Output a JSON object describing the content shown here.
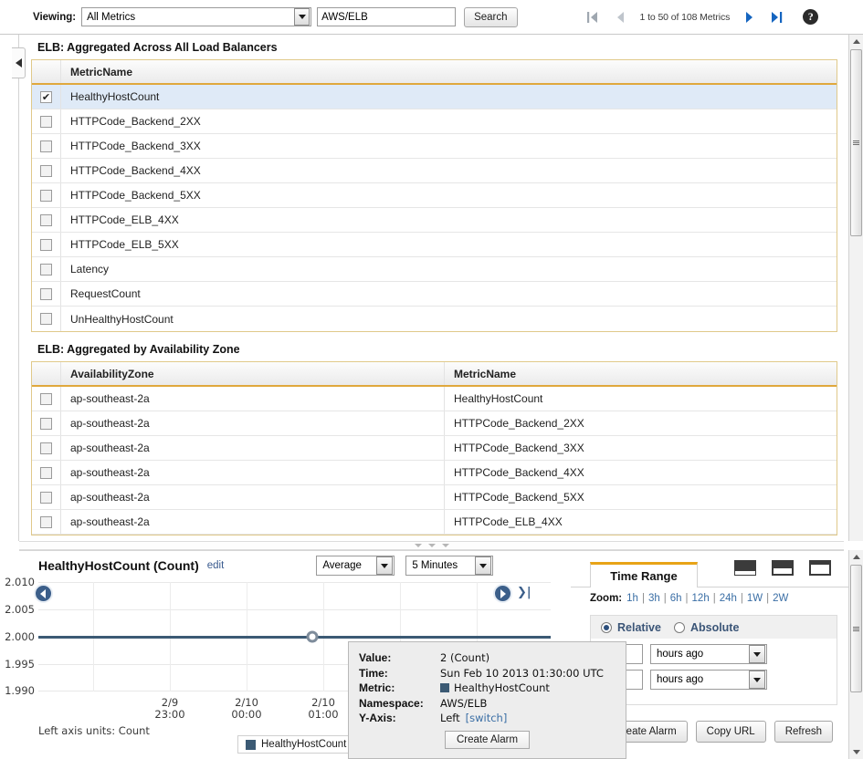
{
  "toolbar": {
    "viewing_label": "Viewing:",
    "namespace_select": "All Metrics",
    "filter_value": "AWS/ELB",
    "search_button": "Search",
    "pagination": "1 to 50 of 108 Metrics",
    "help_glyph": "?",
    "first_icon": "|◀",
    "prev_icon": "◀",
    "next_icon": "▶",
    "last_icon": "▶|"
  },
  "sections": [
    {
      "title": "ELB: Aggregated Across All Load Balancers",
      "columns": [
        "MetricName"
      ],
      "rows": [
        {
          "checked": true,
          "metric": "HealthyHostCount"
        },
        {
          "checked": false,
          "metric": "HTTPCode_Backend_2XX"
        },
        {
          "checked": false,
          "metric": "HTTPCode_Backend_3XX"
        },
        {
          "checked": false,
          "metric": "HTTPCode_Backend_4XX"
        },
        {
          "checked": false,
          "metric": "HTTPCode_Backend_5XX"
        },
        {
          "checked": false,
          "metric": "HTTPCode_ELB_4XX"
        },
        {
          "checked": false,
          "metric": "HTTPCode_ELB_5XX"
        },
        {
          "checked": false,
          "metric": "Latency"
        },
        {
          "checked": false,
          "metric": "RequestCount"
        },
        {
          "checked": false,
          "metric": "UnHealthyHostCount"
        }
      ]
    },
    {
      "title": "ELB: Aggregated by Availability Zone",
      "columns": [
        "AvailabilityZone",
        "MetricName"
      ],
      "rows": [
        {
          "checked": false,
          "zone": "ap-southeast-2a",
          "metric": "HealthyHostCount"
        },
        {
          "checked": false,
          "zone": "ap-southeast-2a",
          "metric": "HTTPCode_Backend_2XX"
        },
        {
          "checked": false,
          "zone": "ap-southeast-2a",
          "metric": "HTTPCode_Backend_3XX"
        },
        {
          "checked": false,
          "zone": "ap-southeast-2a",
          "metric": "HTTPCode_Backend_4XX"
        },
        {
          "checked": false,
          "zone": "ap-southeast-2a",
          "metric": "HTTPCode_Backend_5XX"
        },
        {
          "checked": false,
          "zone": "ap-southeast-2a",
          "metric": "HTTPCode_ELB_4XX"
        }
      ]
    }
  ],
  "chart_panel": {
    "title": "HealthyHostCount (Count)",
    "edit_link": "edit",
    "statistic": "Average",
    "period": "5 Minutes",
    "axis_units": "Left axis units: Count",
    "legend_label": "HealthyHostCount",
    "prev_icon": "❮",
    "next_icon": "❯",
    "last_icon": "❯|"
  },
  "chart_data": {
    "type": "line",
    "title": "HealthyHostCount (Count)",
    "xlabel": "",
    "ylabel": "Count",
    "ylim": [
      1.99,
      2.01
    ],
    "yticks": [
      "2.010",
      "2.005",
      "2.000",
      "1.995",
      "1.990"
    ],
    "ytick_values": [
      2.01,
      2.005,
      2.0,
      1.995,
      1.99
    ],
    "xticks": [
      "2/9\n23:00",
      "2/10\n00:00",
      "2/10\n01:00"
    ],
    "xtick_labels": [
      {
        "date": "2/9",
        "time": "23:00"
      },
      {
        "date": "2/10",
        "time": "00:00"
      },
      {
        "date": "2/10",
        "time": "01:00"
      }
    ],
    "grid": true,
    "legend_position": "bottom",
    "series": [
      {
        "name": "HealthyHostCount",
        "color": "#3b5a74",
        "values": [
          2,
          2,
          2,
          2,
          2,
          2,
          2,
          2,
          2,
          2,
          2,
          2
        ],
        "constant": 2
      }
    ],
    "highlighted_point": {
      "value": 2,
      "unit": "Count",
      "time": "Sun Feb 10 2013 01:30:00 UTC"
    }
  },
  "tooltip": {
    "rows": [
      {
        "key": "Value:",
        "value": "2 (Count)"
      },
      {
        "key": "Time:",
        "value": "Sun Feb 10 2013 01:30:00 UTC"
      },
      {
        "key": "Metric:",
        "value": "HealthyHostCount",
        "swatch": "#3b5a74"
      },
      {
        "key": "Namespace:",
        "value": "AWS/ELB"
      },
      {
        "key": "Y-Axis:",
        "value": "Left",
        "link": "[switch]"
      }
    ],
    "create_alarm_button": "Create Alarm"
  },
  "time_range": {
    "tab_label": "Time Range",
    "zoom_label": "Zoom:",
    "zoom_options": [
      "1h",
      "3h",
      "6h",
      "12h",
      "24h",
      "1W",
      "2W"
    ],
    "mode_relative": "Relative",
    "mode_absolute": "Absolute",
    "relative_selected": true,
    "from_value": "",
    "from_units": "hours ago",
    "to_value": "",
    "to_units": "hours ago",
    "buttons": [
      "Create Alarm",
      "Copy URL",
      "Refresh"
    ],
    "create_alarm_visible_text": "te Alarm"
  },
  "colors": {
    "accent_orange": "#e8a317",
    "link_blue": "#3a6ea5",
    "series": "#3b5a74",
    "selected_row": "#dfeaf7"
  }
}
